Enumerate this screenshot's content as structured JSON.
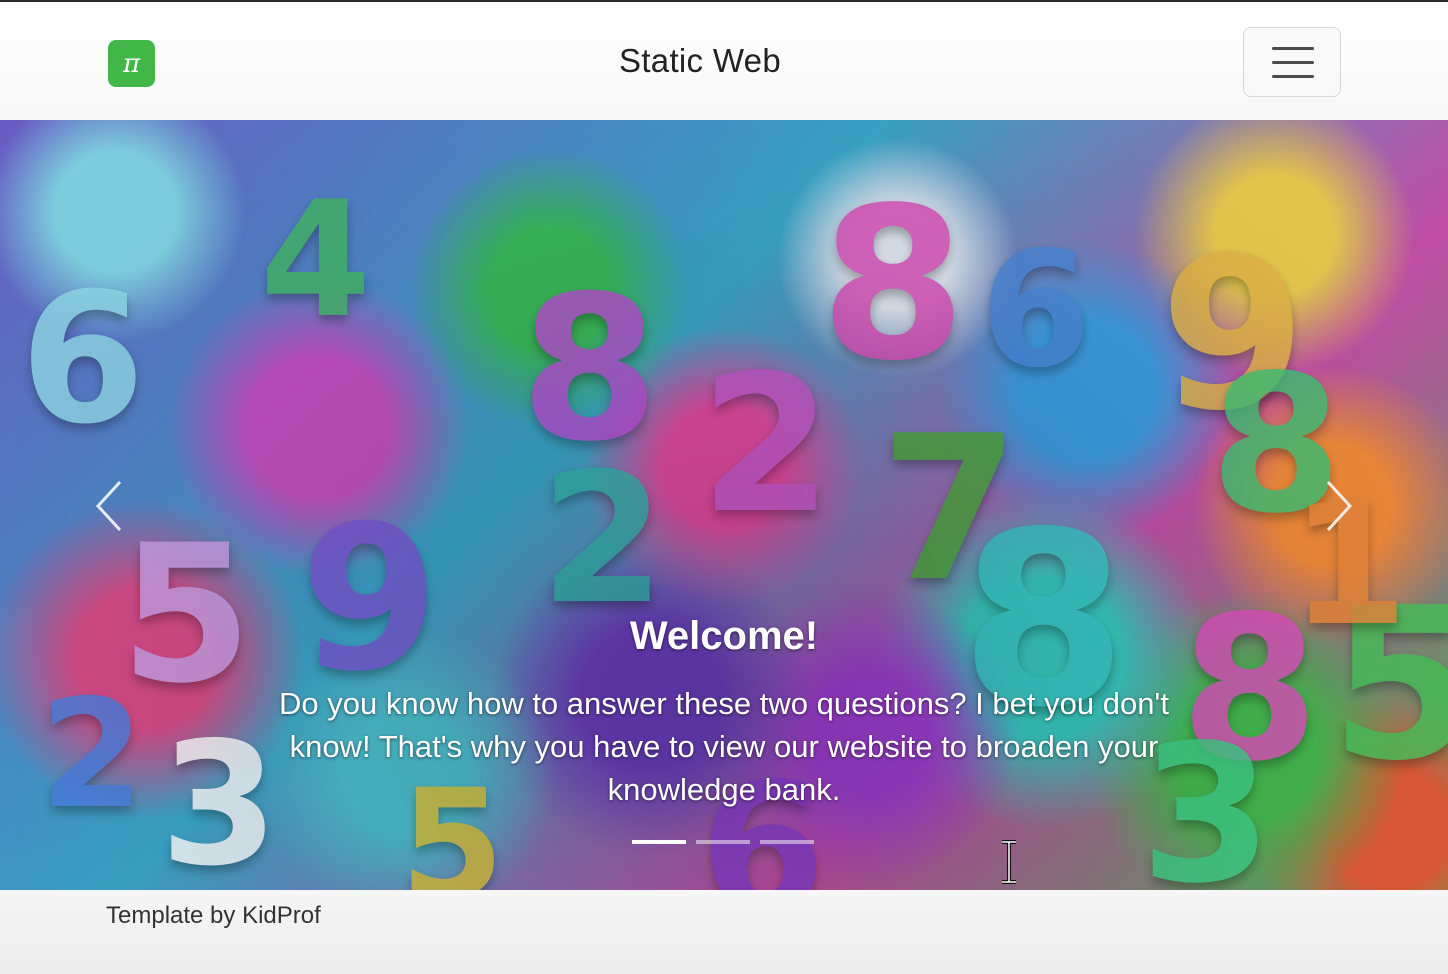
{
  "navbar": {
    "logo_glyph": "π",
    "brand_title": "Static Web",
    "menu_icon": "hamburger-icon",
    "accent_color": "#43b649"
  },
  "carousel": {
    "slide_image": "colorful-3d-numbers-background",
    "title": "Welcome!",
    "text": "Do you know how to answer these two questions? I bet you don't know! That's why you have to view our website to broaden your knowledge bank.",
    "prev_icon": "chevron-left-icon",
    "next_icon": "chevron-right-icon",
    "indicators": [
      {
        "active": true
      },
      {
        "active": false
      },
      {
        "active": false
      }
    ]
  },
  "footer": {
    "text": "Template by KidProf"
  }
}
